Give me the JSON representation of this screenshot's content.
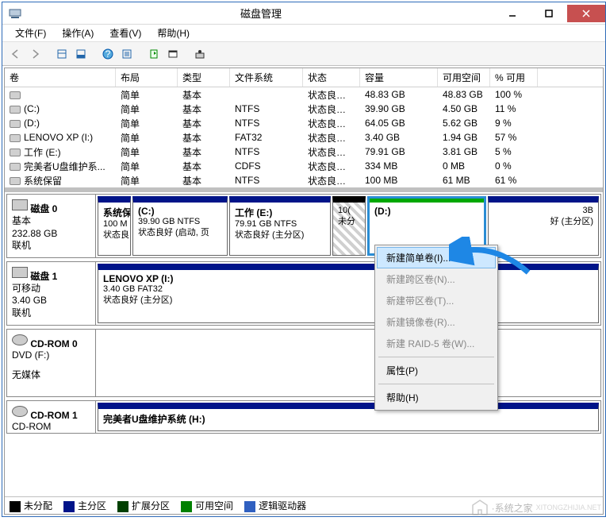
{
  "window": {
    "title": "磁盘管理"
  },
  "menubar": [
    {
      "label": "文件(F)"
    },
    {
      "label": "操作(A)"
    },
    {
      "label": "查看(V)"
    },
    {
      "label": "帮助(H)"
    }
  ],
  "columns": {
    "volume": "卷",
    "layout": "布局",
    "type": "类型",
    "filesystem": "文件系统",
    "status": "状态",
    "capacity": "容量",
    "free": "可用空间",
    "pct": "% 可用"
  },
  "volumes": [
    {
      "name": "",
      "layout": "简单",
      "type": "基本",
      "fs": "",
      "status": "状态良好 (...",
      "cap": "48.83 GB",
      "free": "48.83 GB",
      "pct": "100 %"
    },
    {
      "name": "(C:)",
      "layout": "简单",
      "type": "基本",
      "fs": "NTFS",
      "status": "状态良好 (...",
      "cap": "39.90 GB",
      "free": "4.50 GB",
      "pct": "11 %"
    },
    {
      "name": "(D:)",
      "layout": "简单",
      "type": "基本",
      "fs": "NTFS",
      "status": "状态良好 (...",
      "cap": "64.05 GB",
      "free": "5.62 GB",
      "pct": "9 %"
    },
    {
      "name": "LENOVO XP (I:)",
      "layout": "简单",
      "type": "基本",
      "fs": "FAT32",
      "status": "状态良好 (...",
      "cap": "3.40 GB",
      "free": "1.94 GB",
      "pct": "57 %"
    },
    {
      "name": "工作 (E:)",
      "layout": "简单",
      "type": "基本",
      "fs": "NTFS",
      "status": "状态良好 (...",
      "cap": "79.91 GB",
      "free": "3.81 GB",
      "pct": "5 %"
    },
    {
      "name": "完美者U盘维护系...",
      "layout": "简单",
      "type": "基本",
      "fs": "CDFS",
      "status": "状态良好 (...",
      "cap": "334 MB",
      "free": "0 MB",
      "pct": "0 %"
    },
    {
      "name": "系统保留",
      "layout": "简单",
      "type": "基本",
      "fs": "NTFS",
      "status": "状态良好 (...",
      "cap": "100 MB",
      "free": "61 MB",
      "pct": "61 %"
    }
  ],
  "disks": {
    "d0": {
      "title": "磁盘 0",
      "type": "基本",
      "size": "232.88 GB",
      "status": "联机",
      "p_sys": {
        "t": "系统保",
        "l1": "100 M",
        "l2": "状态良"
      },
      "p_c": {
        "t": "(C:)",
        "l1": "39.90 GB NTFS",
        "l2": "状态良好 (启动, 页"
      },
      "p_e": {
        "t": "工作  (E:)",
        "l1": "79.91 GB NTFS",
        "l2": "状态良好 (主分区)"
      },
      "p_un": {
        "t": "",
        "l1": "10(",
        "l2": "未分"
      },
      "p_d": {
        "t": "(D:)",
        "l1": "",
        "l2": ""
      },
      "p_ext": {
        "t": "",
        "l1": "3B",
        "l2": "好 (主分区)"
      }
    },
    "d1": {
      "title": "磁盘 1",
      "type": "可移动",
      "size": "3.40 GB",
      "status": "联机",
      "p": {
        "t": "LENOVO XP  (I:)",
        "l1": "3.40 GB FAT32",
        "l2": "状态良好 (主分区)"
      }
    },
    "cd0": {
      "title": "CD-ROM 0",
      "type": "DVD (F:)",
      "status": "无媒体"
    },
    "cd1": {
      "title": "CD-ROM 1",
      "type": "CD-ROM",
      "p": {
        "t": "完美者U盘维护系统  (H:)"
      }
    }
  },
  "legend": {
    "unalloc": "未分配",
    "primary": "主分区",
    "extended": "扩展分区",
    "free": "可用空间",
    "logical": "逻辑驱动器"
  },
  "context": {
    "simple": "新建简单卷(I)...",
    "spanned": "新建跨区卷(N)...",
    "striped": "新建带区卷(T)...",
    "mirror": "新建镜像卷(R)...",
    "raid5": "新建 RAID-5 卷(W)...",
    "props": "属性(P)",
    "help": "帮助(H)"
  },
  "watermark": "·系统之家"
}
